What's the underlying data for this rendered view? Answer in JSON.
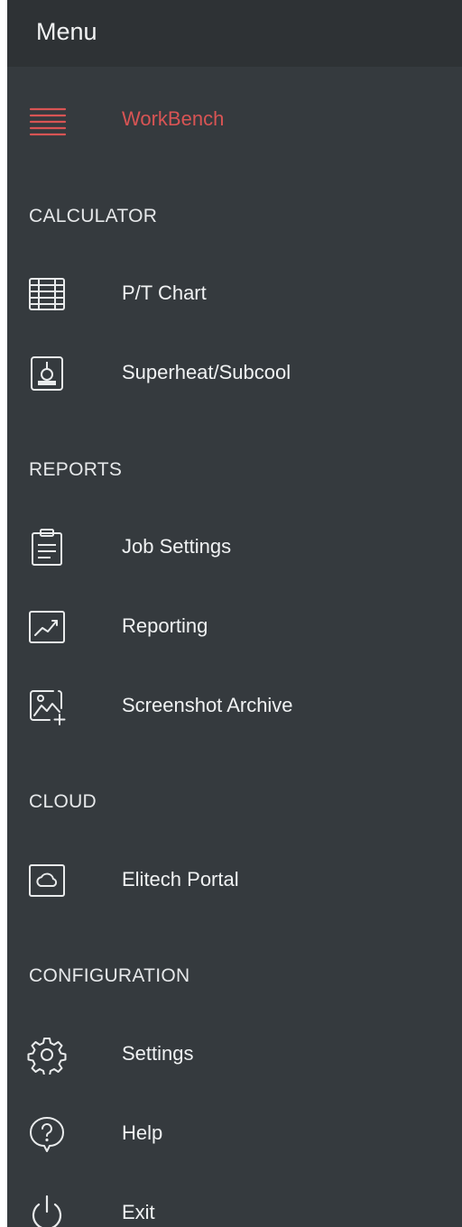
{
  "drawer": {
    "title": "Menu",
    "accent_color": "#d85454",
    "background_color": "#353a3e"
  },
  "workbench": {
    "label": "WorkBench",
    "icon": "hamburger-icon",
    "active": true
  },
  "sections": {
    "calculator": {
      "label": "CALCULATOR",
      "items": [
        {
          "label": "P/T Chart",
          "icon": "table-icon"
        },
        {
          "label": "Superheat/Subcool",
          "icon": "thermometer-icon"
        }
      ]
    },
    "reports": {
      "label": "REPORTS",
      "items": [
        {
          "label": "Job Settings",
          "icon": "clipboard-icon"
        },
        {
          "label": "Reporting",
          "icon": "trend-chart-icon"
        },
        {
          "label": "Screenshot Archive",
          "icon": "image-add-icon"
        }
      ]
    },
    "cloud": {
      "label": "CLOUD",
      "items": [
        {
          "label": "Elitech Portal",
          "icon": "cloud-icon"
        }
      ]
    },
    "configuration": {
      "label": "CONFIGURATION",
      "items": [
        {
          "label": "Settings",
          "icon": "gear-icon"
        },
        {
          "label": "Help",
          "icon": "help-icon"
        },
        {
          "label": "Exit",
          "icon": "power-icon"
        }
      ]
    }
  }
}
